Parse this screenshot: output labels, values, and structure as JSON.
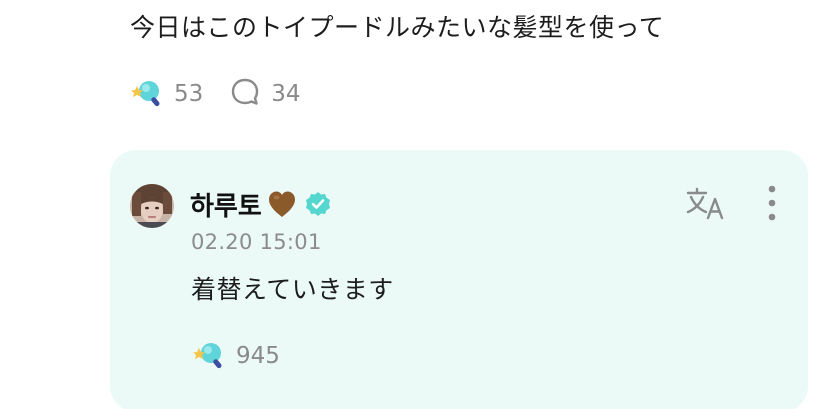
{
  "post": {
    "text": "今日はこのトイプードルみたいな髪型を使って",
    "like_icon": "light-stick-icon",
    "like_count": "53",
    "comment_icon": "comment-bubble-icon",
    "comment_count": "34"
  },
  "reply": {
    "author_name": "하루토",
    "author_emoji": "🤎",
    "verified_icon": "verified-badge-icon",
    "timestamp": "02.20 15:01",
    "text": "着替えていきます",
    "like_icon": "light-stick-icon",
    "like_count": "945",
    "translate_icon": "translate-icon",
    "more_icon": "more-vertical-icon"
  },
  "colors": {
    "card_background": "#ebfaf7",
    "accent_teal": "#55d6cf",
    "muted_text": "#8a8a8a"
  }
}
